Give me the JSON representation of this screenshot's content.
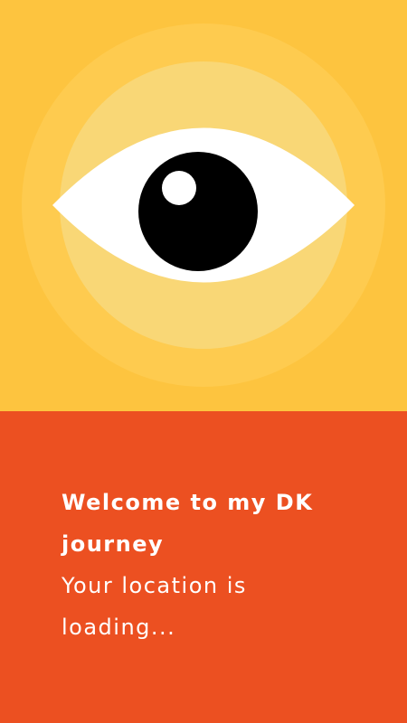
{
  "colors": {
    "top_background": "#FDC43F",
    "bottom_background": "#EC5021",
    "halo_outer": "#FECB4F",
    "halo_inner": "#F9D776",
    "eye_white": "#FFFFFF",
    "pupil": "#000000",
    "text": "#FFFFFF"
  },
  "icon": {
    "name": "eye-icon"
  },
  "message": {
    "welcome": "Welcome to my DK journey",
    "status": "Your location is loading..."
  }
}
